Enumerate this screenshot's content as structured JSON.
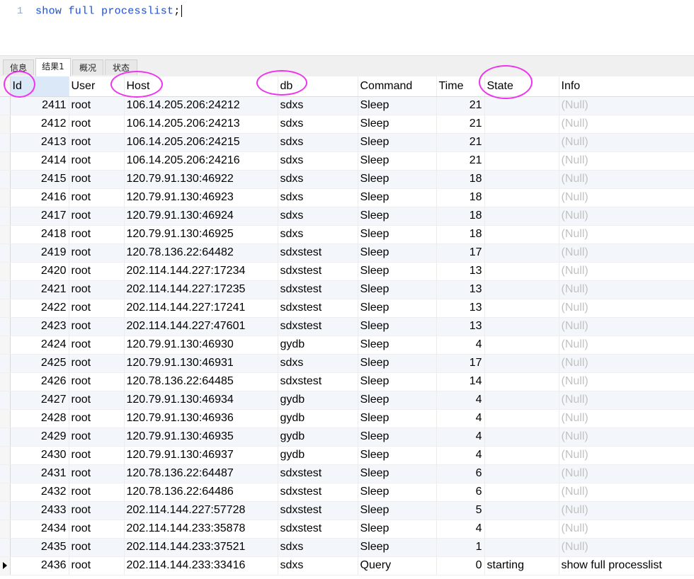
{
  "editor": {
    "line_number": "1",
    "code_keywords": "show full processlist",
    "code_punct": ";"
  },
  "tabs": [
    {
      "label": "信息",
      "active": false
    },
    {
      "label": "结果1",
      "active": true
    },
    {
      "label": "概况",
      "active": false
    },
    {
      "label": "状态",
      "active": false
    }
  ],
  "columns": [
    "Id",
    "User",
    "Host",
    "db",
    "Command",
    "Time",
    "State",
    "Info"
  ],
  "rows": [
    [
      "2411",
      "root",
      "106.14.205.206:24212",
      "sdxs",
      "Sleep",
      "21",
      "",
      "(Null)"
    ],
    [
      "2412",
      "root",
      "106.14.205.206:24213",
      "sdxs",
      "Sleep",
      "21",
      "",
      "(Null)"
    ],
    [
      "2413",
      "root",
      "106.14.205.206:24215",
      "sdxs",
      "Sleep",
      "21",
      "",
      "(Null)"
    ],
    [
      "2414",
      "root",
      "106.14.205.206:24216",
      "sdxs",
      "Sleep",
      "21",
      "",
      "(Null)"
    ],
    [
      "2415",
      "root",
      "120.79.91.130:46922",
      "sdxs",
      "Sleep",
      "18",
      "",
      "(Null)"
    ],
    [
      "2416",
      "root",
      "120.79.91.130:46923",
      "sdxs",
      "Sleep",
      "18",
      "",
      "(Null)"
    ],
    [
      "2417",
      "root",
      "120.79.91.130:46924",
      "sdxs",
      "Sleep",
      "18",
      "",
      "(Null)"
    ],
    [
      "2418",
      "root",
      "120.79.91.130:46925",
      "sdxs",
      "Sleep",
      "18",
      "",
      "(Null)"
    ],
    [
      "2419",
      "root",
      "120.78.136.22:64482",
      "sdxstest",
      "Sleep",
      "17",
      "",
      "(Null)"
    ],
    [
      "2420",
      "root",
      "202.114.144.227:17234",
      "sdxstest",
      "Sleep",
      "13",
      "",
      "(Null)"
    ],
    [
      "2421",
      "root",
      "202.114.144.227:17235",
      "sdxstest",
      "Sleep",
      "13",
      "",
      "(Null)"
    ],
    [
      "2422",
      "root",
      "202.114.144.227:17241",
      "sdxstest",
      "Sleep",
      "13",
      "",
      "(Null)"
    ],
    [
      "2423",
      "root",
      "202.114.144.227:47601",
      "sdxstest",
      "Sleep",
      "13",
      "",
      "(Null)"
    ],
    [
      "2424",
      "root",
      "120.79.91.130:46930",
      "gydb",
      "Sleep",
      "4",
      "",
      "(Null)"
    ],
    [
      "2425",
      "root",
      "120.79.91.130:46931",
      "sdxs",
      "Sleep",
      "17",
      "",
      "(Null)"
    ],
    [
      "2426",
      "root",
      "120.78.136.22:64485",
      "sdxstest",
      "Sleep",
      "14",
      "",
      "(Null)"
    ],
    [
      "2427",
      "root",
      "120.79.91.130:46934",
      "gydb",
      "Sleep",
      "4",
      "",
      "(Null)"
    ],
    [
      "2428",
      "root",
      "120.79.91.130:46936",
      "gydb",
      "Sleep",
      "4",
      "",
      "(Null)"
    ],
    [
      "2429",
      "root",
      "120.79.91.130:46935",
      "gydb",
      "Sleep",
      "4",
      "",
      "(Null)"
    ],
    [
      "2430",
      "root",
      "120.79.91.130:46937",
      "gydb",
      "Sleep",
      "4",
      "",
      "(Null)"
    ],
    [
      "2431",
      "root",
      "120.78.136.22:64487",
      "sdxstest",
      "Sleep",
      "6",
      "",
      "(Null)"
    ],
    [
      "2432",
      "root",
      "120.78.136.22:64486",
      "sdxstest",
      "Sleep",
      "6",
      "",
      "(Null)"
    ],
    [
      "2433",
      "root",
      "202.114.144.227:57728",
      "sdxstest",
      "Sleep",
      "5",
      "",
      "(Null)"
    ],
    [
      "2434",
      "root",
      "202.114.144.233:35878",
      "sdxstest",
      "Sleep",
      "4",
      "",
      "(Null)"
    ],
    [
      "2435",
      "root",
      "202.114.144.233:37521",
      "sdxs",
      "Sleep",
      "1",
      "",
      "(Null)"
    ],
    [
      "2436",
      "root",
      "202.114.144.233:33416",
      "sdxs",
      "Query",
      "0",
      "starting",
      "show full processlist"
    ]
  ],
  "current_row_index": 25,
  "colors": {
    "keyword": "#1a4fd0",
    "annotation": "#ee33ee",
    "null_text": "#c2c2c2",
    "alt_row": "#f3f7fc"
  }
}
